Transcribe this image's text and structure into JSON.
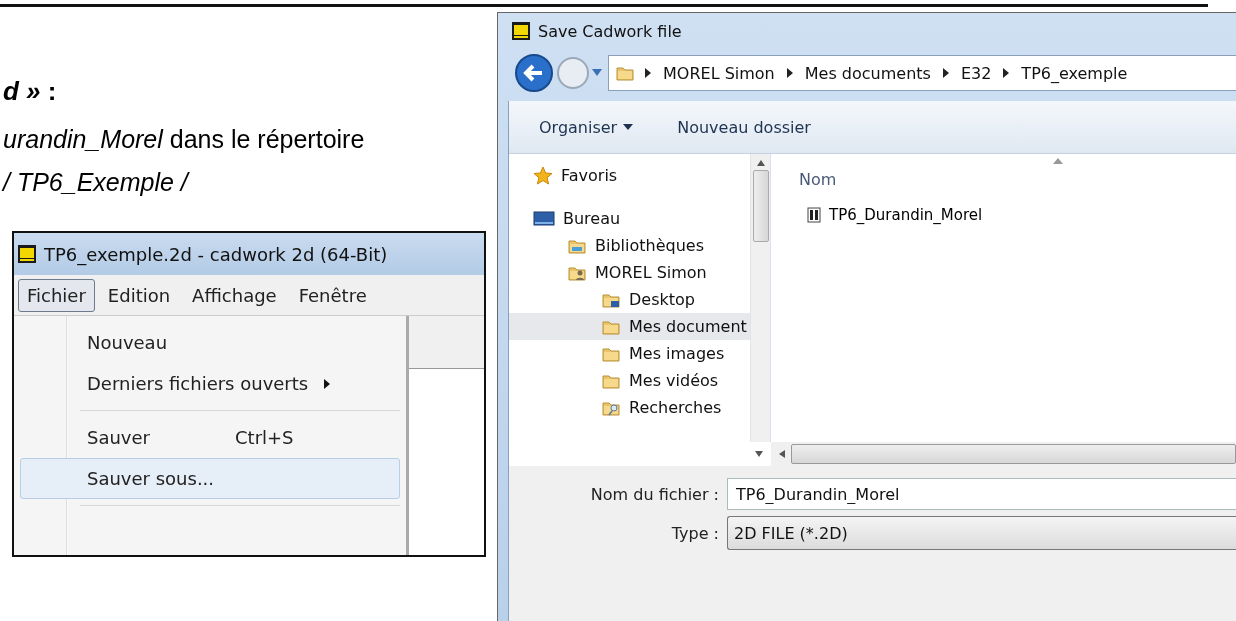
{
  "document": {
    "heading": "*d »* :",
    "line": "*urandin_Morel* dans le répertoire",
    "path": "/ TP6_Exemple /"
  },
  "app_window": {
    "title": "TP6_exemple.2d - cadwork 2d (64-Bit)",
    "menubar": [
      {
        "label": "Fichier",
        "selected": true
      },
      {
        "label": "Edition",
        "selected": false
      },
      {
        "label": "Affichage",
        "selected": false
      },
      {
        "label": "Fenêtre",
        "selected": false
      }
    ],
    "menu": [
      {
        "kind": "item",
        "label": "Nouveau",
        "selected": false
      },
      {
        "kind": "submenu",
        "label": "Derniers fichiers ouverts",
        "selected": false
      },
      {
        "kind": "separator"
      },
      {
        "kind": "item",
        "label": "Sauver",
        "shortcut": "Ctrl+S",
        "selected": false
      },
      {
        "kind": "item",
        "label": "Sauver sous...",
        "selected": true
      },
      {
        "kind": "separator"
      }
    ]
  },
  "dialog": {
    "title": "Save Cadwork file",
    "breadcrumb": [
      "MOREL Simon",
      "Mes documents",
      "E32",
      "TP6_exemple"
    ],
    "toolbar": [
      {
        "label": "Organiser",
        "dropdown": true
      },
      {
        "label": "Nouveau dossier",
        "dropdown": false
      }
    ],
    "nav": [
      {
        "kind": "star",
        "label": "Favoris",
        "selected": false
      },
      {
        "kind": "desktop",
        "label": "Bureau",
        "selected": false,
        "children": [
          {
            "kind": "library",
            "label": "Bibliothèques",
            "selected": false
          },
          {
            "kind": "user",
            "label": "MOREL Simon",
            "selected": false,
            "children": [
              {
                "kind": "desktop-folder",
                "label": "Desktop",
                "selected": false
              },
              {
                "kind": "folder",
                "label": "Mes document",
                "selected": true
              },
              {
                "kind": "folder",
                "label": "Mes images",
                "selected": false
              },
              {
                "kind": "folder",
                "label": "Mes vidéos",
                "selected": false
              },
              {
                "kind": "search-folder",
                "label": "Recherches",
                "selected": false
              }
            ]
          }
        ]
      }
    ],
    "column": "Nom",
    "files": [
      "TP6_Durandin_Morel"
    ],
    "filename_label": "Nom du fichier :",
    "filename": "TP6_Durandin_Morel",
    "type_label": "Type :",
    "type": "2D FILE (*.2D)"
  }
}
